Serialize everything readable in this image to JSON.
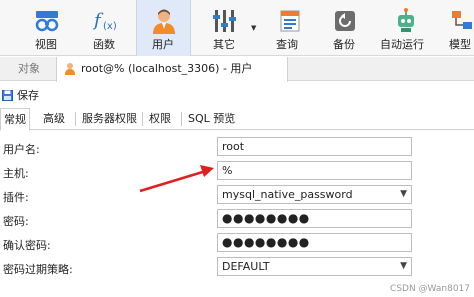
{
  "toolbar": {
    "items": [
      {
        "label": "视图"
      },
      {
        "label": "函数"
      },
      {
        "label": "用户"
      },
      {
        "label": "其它"
      },
      {
        "label": "查询"
      },
      {
        "label": "备份"
      },
      {
        "label": "自动运行"
      },
      {
        "label": "模型"
      }
    ]
  },
  "tabs": {
    "objects_label": "对象",
    "active_tab_title": "root@% (localhost_3306) - 用户"
  },
  "actions": {
    "save_label": "保存"
  },
  "subtabs": [
    "常规",
    "高级",
    "服务器权限",
    "权限",
    "SQL 预览"
  ],
  "form": {
    "username_label": "用户名:",
    "username_value": "root",
    "host_label": "主机:",
    "host_value": "%",
    "plugin_label": "插件:",
    "plugin_value": "mysql_native_password",
    "password_label": "密码:",
    "password_value": "●●●●●●●●",
    "confirm_password_label": "确认密码:",
    "confirm_password_value": "●●●●●●●●",
    "password_expire_label": "密码过期策略:",
    "password_expire_value": "DEFAULT"
  },
  "watermark": "CSDN @Wan8017",
  "colors": {
    "active_toolbar_bg": "#dfe9f7",
    "annotation_arrow": "#e02020",
    "brand_blue": "#2b6cc4"
  }
}
